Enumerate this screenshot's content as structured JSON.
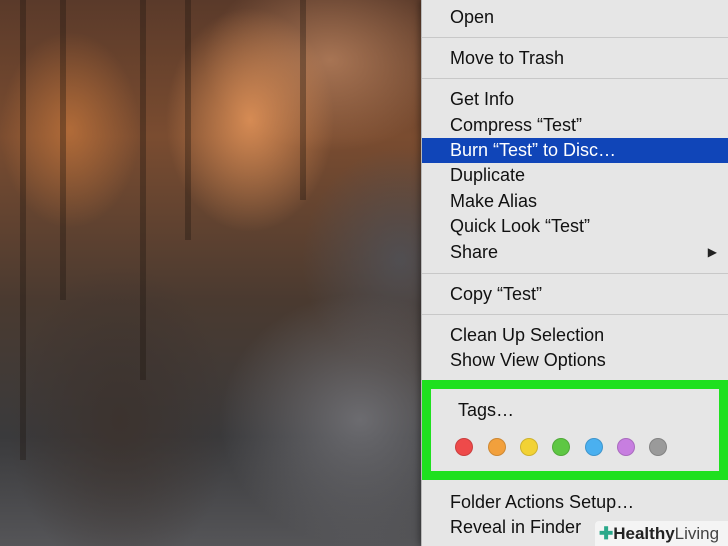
{
  "menu": {
    "open": "Open",
    "move_to_trash": "Move to Trash",
    "get_info": "Get Info",
    "compress": "Compress “Test”",
    "burn": "Burn “Test” to Disc…",
    "duplicate": "Duplicate",
    "make_alias": "Make Alias",
    "quick_look": "Quick Look “Test”",
    "share": "Share",
    "copy": "Copy “Test”",
    "clean_up": "Clean Up Selection",
    "show_view_options": "Show View Options",
    "tags": "Tags…",
    "folder_actions": "Folder Actions Setup…",
    "reveal": "Reveal in Finder",
    "highlighted_item": "Burn “Test” to Disc…",
    "submenu_arrow": "▶"
  },
  "tag_colors": [
    "#ee4a4a",
    "#f2a03c",
    "#f2d235",
    "#5ec743",
    "#4ab0f0",
    "#c77ee0",
    "#9a9a9a"
  ],
  "colors": {
    "highlight": "#1045b8",
    "annotation_box": "#1fe01f"
  },
  "watermark": {
    "icon": "plus-icon",
    "word1": "Healthy",
    "word2": "Living"
  }
}
